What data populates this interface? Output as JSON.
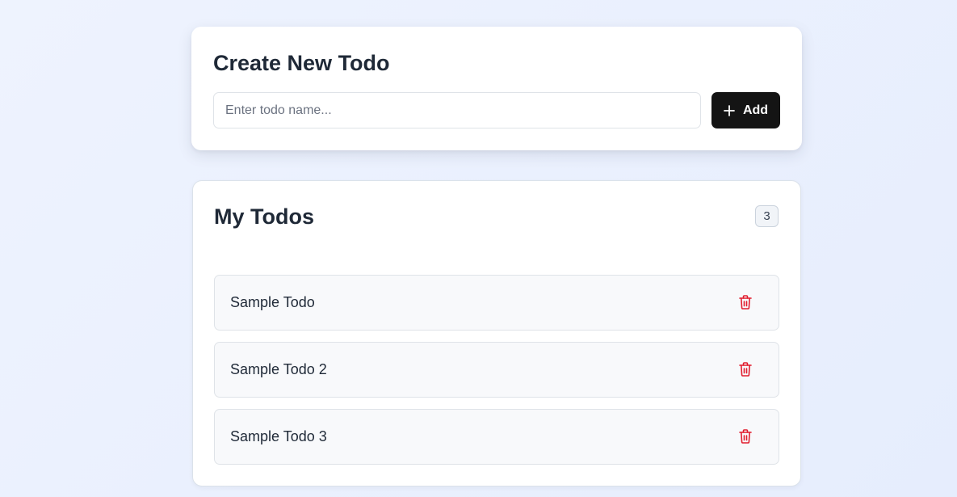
{
  "create_card": {
    "title": "Create New Todo",
    "input": {
      "value": "",
      "placeholder": "Enter todo name..."
    },
    "add_button": {
      "label": "Add",
      "icon": "plus-icon"
    }
  },
  "list_card": {
    "title": "My Todos",
    "count": "3",
    "items": [
      {
        "name": "Sample Todo",
        "action_icon": "trash-icon"
      },
      {
        "name": "Sample Todo 2",
        "action_icon": "trash-icon"
      },
      {
        "name": "Sample Todo 3",
        "action_icon": "trash-icon"
      }
    ]
  },
  "colors": {
    "accent_button": "#141414",
    "delete_icon": "#e11d2e",
    "background": "#eaf0fd"
  }
}
